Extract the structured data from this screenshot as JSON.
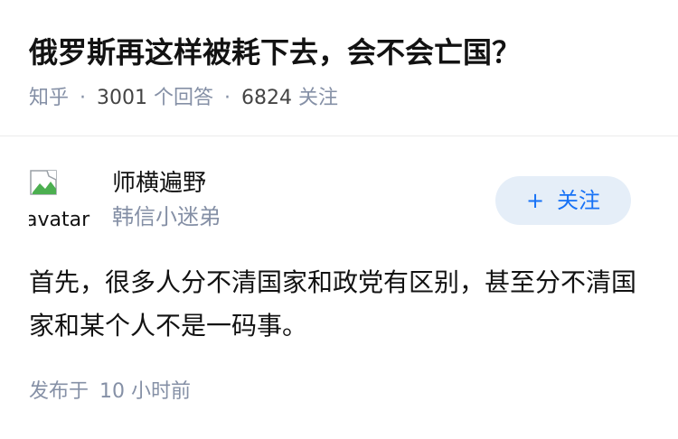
{
  "question": {
    "title": "俄罗斯再这样被耗下去，会不会亡国？",
    "source": "知乎",
    "separator": "·",
    "answer_count": "3001",
    "answer_unit": "个回答",
    "follower_count": "6824",
    "follower_unit": "关注"
  },
  "answer": {
    "author": {
      "avatar_alt": "avatar",
      "name": "师横遍野",
      "bio": "韩信小迷弟"
    },
    "follow_button": {
      "plus": "+",
      "label": "关注"
    },
    "content": "首先，很多人分不清国家和政党有区别，甚至分不清国家和某个人不是一码事。",
    "time_prefix": "发布于",
    "time_value": "10 小时前"
  },
  "colors": {
    "accent": "#1772f6",
    "follow_bg": "#e5eef8",
    "meta_gray": "#8590a6",
    "text": "#121212",
    "divider": "#ebebeb"
  },
  "icons": {
    "avatar": "broken-image-icon"
  }
}
